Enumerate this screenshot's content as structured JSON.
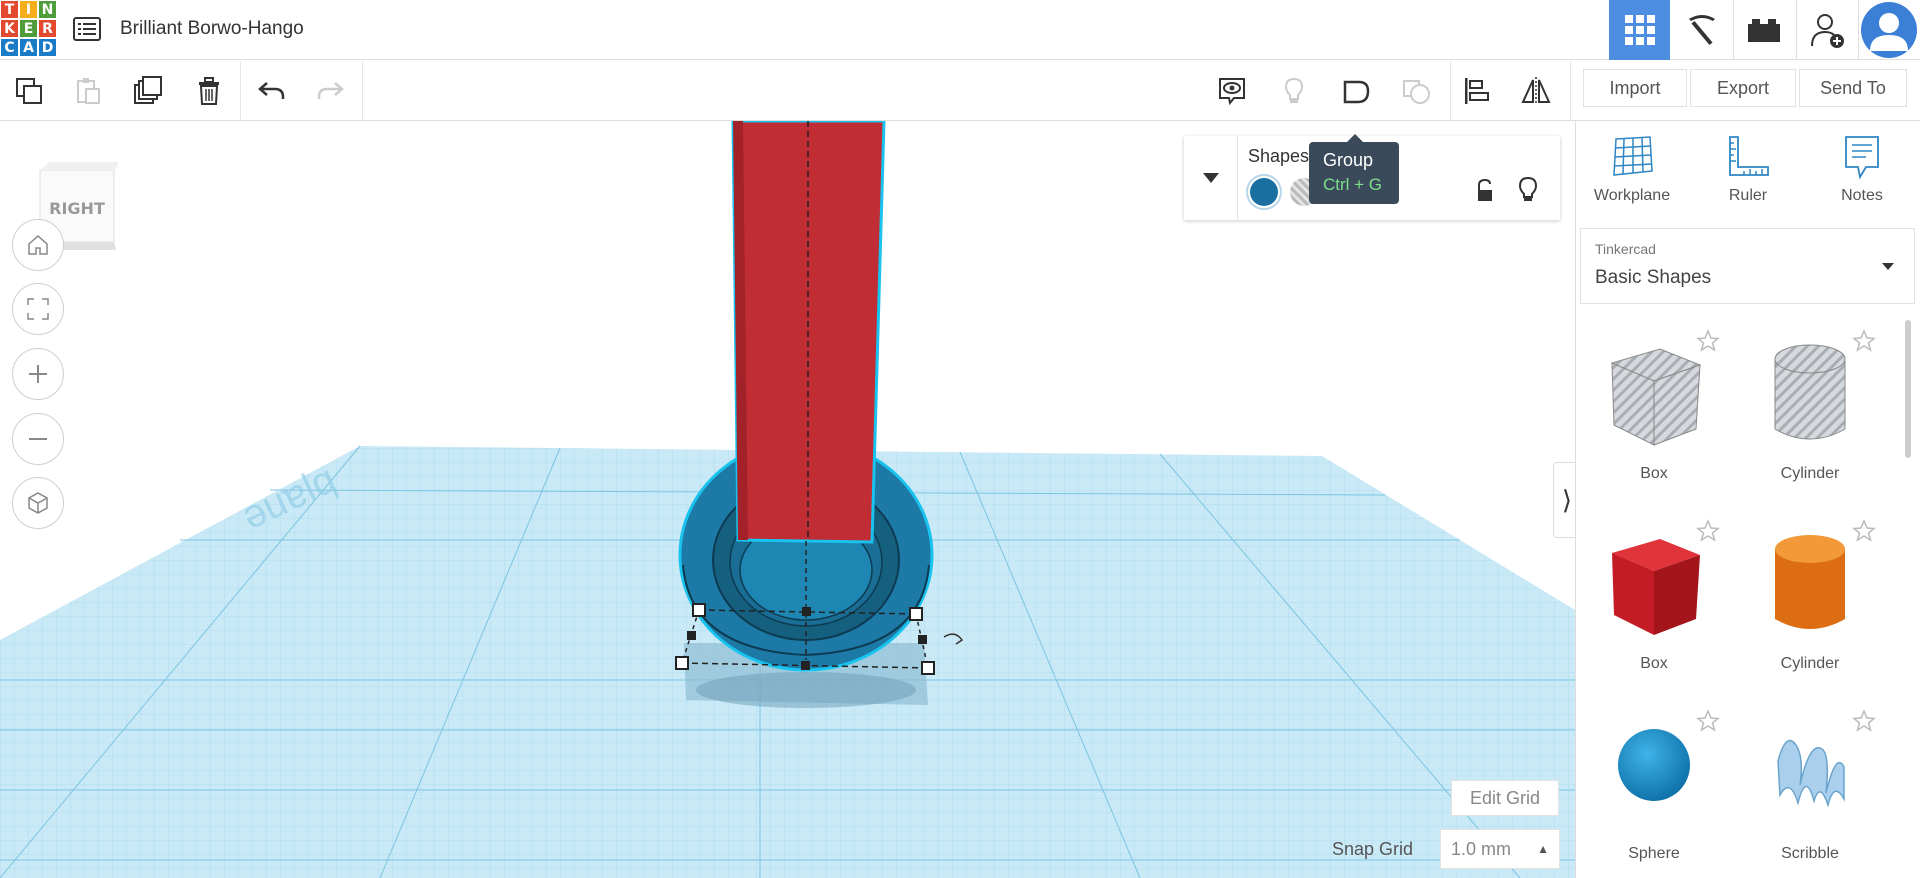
{
  "app": {
    "logo_letters": [
      "T",
      "I",
      "N",
      "K",
      "E",
      "R",
      "C",
      "A",
      "D"
    ],
    "logo_colors": [
      "#e2492f",
      "#f4ae1a",
      "#4f9d3a",
      "#e2492f",
      "#4f9d3a",
      "#e2492f",
      "#1a7bc7",
      "#1a7bc7",
      "#1a7bc7"
    ],
    "title": "Brilliant Borwo-Hango"
  },
  "toolbar": {
    "import_label": "Import",
    "export_label": "Export",
    "send_to_label": "Send To"
  },
  "tooltip": {
    "title": "Group",
    "shortcut": "Ctrl + G"
  },
  "shape_panel": {
    "title": "Shapes",
    "solid_color": "#1a6fa0"
  },
  "view_cube": {
    "face_label": "RIGHT"
  },
  "grid": {
    "edit_grid_label": "Edit Grid",
    "snap_label": "Snap Grid",
    "snap_value": "1.0 mm"
  },
  "right_panel": {
    "tools": [
      {
        "label": "Workplane"
      },
      {
        "label": "Ruler"
      },
      {
        "label": "Notes"
      }
    ],
    "library_provider": "Tinkercad",
    "library_name": "Basic Shapes",
    "shapes": [
      {
        "name": "Box",
        "color": "#b8bcc2",
        "kind": "box-hole"
      },
      {
        "name": "Cylinder",
        "color": "#b8bcc2",
        "kind": "cyl-hole"
      },
      {
        "name": "Box",
        "color": "#d42427",
        "kind": "box"
      },
      {
        "name": "Cylinder",
        "color": "#e87a1d",
        "kind": "cyl"
      },
      {
        "name": "Sphere",
        "color": "#1a8fcc",
        "kind": "sphere"
      },
      {
        "name": "Scribble",
        "color": "#8fc1e3",
        "kind": "scribble"
      }
    ]
  },
  "accent_color": "#4e8ee1"
}
